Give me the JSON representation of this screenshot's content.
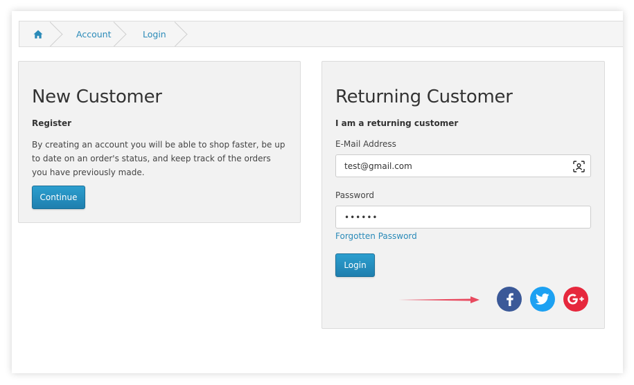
{
  "breadcrumb": {
    "items": [
      "Account",
      "Login"
    ]
  },
  "new_customer": {
    "title": "New Customer",
    "subtitle": "Register",
    "description": "By creating an account you will be able to shop faster, be up to date on an order's status, and keep track of the orders you have previously made.",
    "continue_label": "Continue"
  },
  "returning_customer": {
    "title": "Returning Customer",
    "subtitle": "I am a returning customer",
    "email_label": "E-Mail Address",
    "email_value": "test@gmail.com",
    "password_label": "Password",
    "password_value": "••••••",
    "forgot_label": "Forgotten Password",
    "login_label": "Login"
  },
  "social": {
    "icons": [
      "facebook-icon",
      "twitter-icon",
      "google-plus-icon"
    ]
  },
  "colors": {
    "link": "#2a8ab8",
    "button": "#2387b8",
    "facebook": "#3b5998",
    "twitter": "#1da1f2",
    "google_plus": "#e6283d",
    "arrow": "#e84a5f"
  }
}
